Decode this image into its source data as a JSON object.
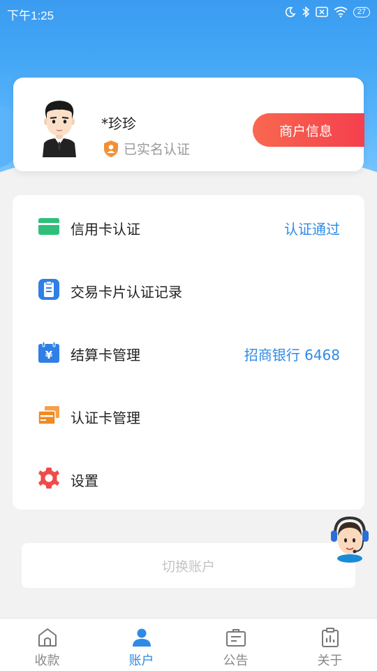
{
  "status_bar": {
    "time": "下午1:25",
    "battery": "27"
  },
  "profile": {
    "name": "*珍珍",
    "verified_text": "已实名认证",
    "merchant_button": "商户信息"
  },
  "menu": {
    "items": [
      {
        "label": "信用卡认证",
        "value": "认证通过",
        "icon": "credit-card-icon"
      },
      {
        "label": "交易卡片认证记录",
        "value": "",
        "icon": "clipboard-icon"
      },
      {
        "label": "结算卡管理",
        "value": "招商银行 6468",
        "icon": "calendar-yen-icon"
      },
      {
        "label": "认证卡管理",
        "value": "",
        "icon": "cards-icon"
      },
      {
        "label": "设置",
        "value": "",
        "icon": "gear-icon"
      }
    ]
  },
  "switch_account": "切换账户",
  "tabs": [
    {
      "label": "收款",
      "icon": "home-icon",
      "active": false
    },
    {
      "label": "账户",
      "icon": "user-icon",
      "active": true
    },
    {
      "label": "公告",
      "icon": "notice-icon",
      "active": false
    },
    {
      "label": "关于",
      "icon": "chart-clipboard-icon",
      "active": false
    }
  ],
  "colors": {
    "header": "#45a8f6",
    "accent": "#2e8ae6",
    "merchant_button": "#f55a4e",
    "credit_icon": "#2fbf7a",
    "record_icon": "#2f7fe6",
    "settle_icon": "#2f7fe6",
    "cards_icon": "#f08a24",
    "settings_icon": "#ef4b4b"
  }
}
